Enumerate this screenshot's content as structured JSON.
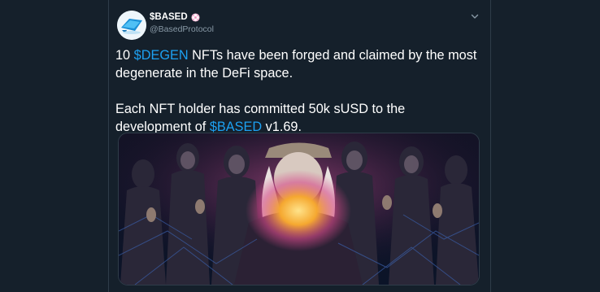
{
  "tweet": {
    "account": {
      "display_name": "$BASED",
      "handle": "@BasedProtocol",
      "badge_icon": "pink-flower-badge-icon",
      "avatar_icon": "based-logo-icon",
      "menu_icon": "chevron-down-icon"
    },
    "body": {
      "p1_before": "10 ",
      "p1_tag": "$DEGEN",
      "p1_after": " NFTs have been forged and claimed by the most degenerate in the DeFi space.",
      "p2_before": "Each NFT holder has committed 50k sUSD to the development of ",
      "p2_tag": "$BASED",
      "p2_after": " v1.69."
    },
    "media": {
      "type": "image",
      "icon": "wizard-gathering-image"
    }
  },
  "colors": {
    "background": "#15202b",
    "text": "#ffffff",
    "secondary_text": "#8899a6",
    "link": "#1da1f2",
    "border": "#2f3c49"
  }
}
